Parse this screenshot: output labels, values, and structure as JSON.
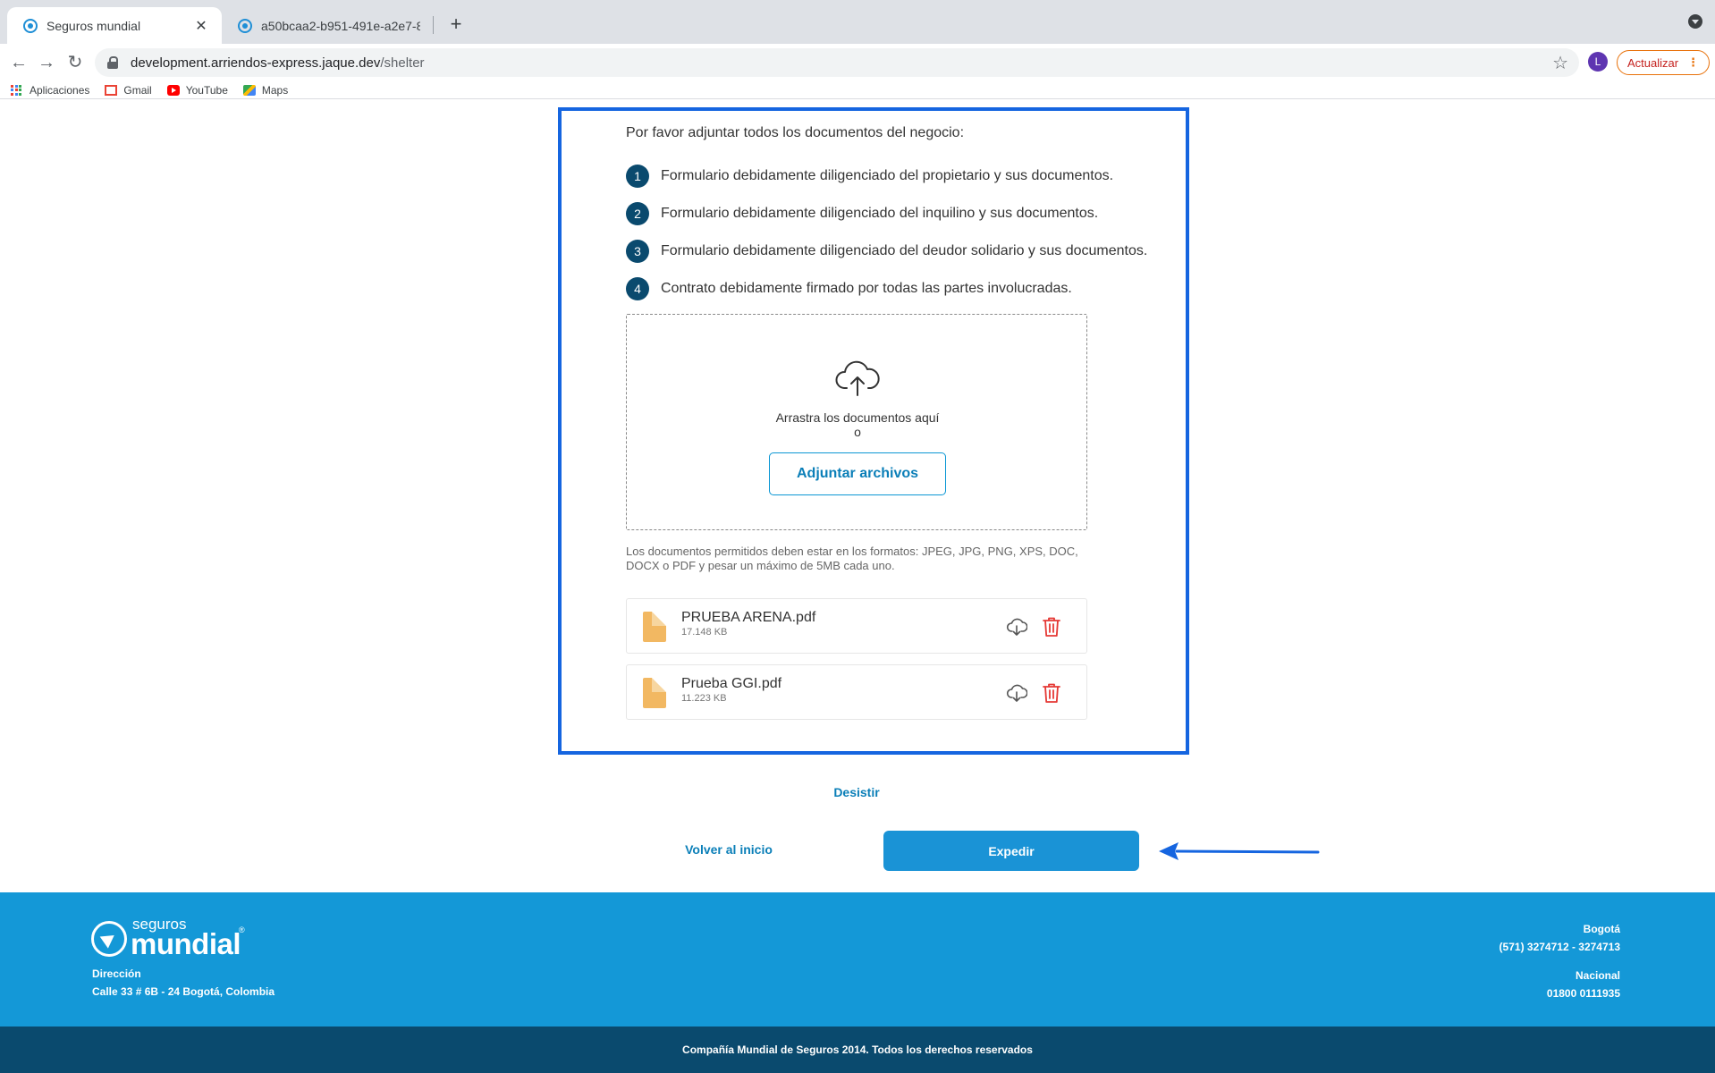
{
  "browser": {
    "tabs": [
      {
        "title": "Seguros mundial",
        "close": "✕"
      },
      {
        "title": "a50bcaa2-b951-491e-a2e7-8(",
        "close": ""
      }
    ],
    "new_tab": "+",
    "nav": {
      "back": "←",
      "forward": "→",
      "reload": "↻"
    },
    "url_host": "development.arriendos-express.jaque.dev",
    "url_path": "/shelter",
    "bookmark_star": "☆",
    "profile_initial": "L",
    "update_label": "Actualizar",
    "update_menu": "⋮",
    "bookmarks": [
      "Aplicaciones",
      "Gmail",
      "YouTube",
      "Maps"
    ]
  },
  "form": {
    "intro": "Por favor adjuntar todos los documentos del negocio:",
    "steps": [
      {
        "num": "1",
        "text": "Formulario debidamente diligenciado del propietario y sus documentos."
      },
      {
        "num": "2",
        "text": "Formulario debidamente diligenciado del inquilino y sus documentos."
      },
      {
        "num": "3",
        "text": "Formulario debidamente diligenciado del deudor solidario y sus documentos."
      },
      {
        "num": "4",
        "text": "Contrato debidamente firmado por todas las partes involucradas."
      }
    ],
    "dropzone": {
      "drag_text": "Arrastra los documentos aquí",
      "or_text": "o",
      "attach_label": "Adjuntar archivos"
    },
    "formats_note": "Los documentos permitidos deben estar en los formatos: JPEG, JPG, PNG, XPS, DOC, DOCX o PDF y pesar un máximo de 5MB cada uno.",
    "files": [
      {
        "name": "PRUEBA ARENA.pdf",
        "size": "17.148 KB"
      },
      {
        "name": "Prueba GGI.pdf",
        "size": "11.223 KB"
      }
    ],
    "desistir_label": "Desistir",
    "volver_label": "Volver al inicio",
    "expedir_label": "Expedir"
  },
  "footer": {
    "logo_small": "seguros",
    "logo_big": "mundial",
    "logo_reg": "®",
    "address_label": "Dirección",
    "address_value": "Calle 33 # 6B - 24 Bogotá, Colombia",
    "city_label": "Bogotá",
    "city_phone": "(571) 3274712 - 3274713",
    "national_label": "Nacional",
    "national_phone": "01800 0111935",
    "copyright": "Compañía Mundial de Seguros 2014. Todos los derechos reservados"
  },
  "colors": {
    "primary": "#1a93d6",
    "link": "#0b7fb8",
    "step_badge": "#0a4a6e",
    "highlight_border": "#1565e0",
    "delete_icon": "#e53935",
    "file_icon": "#f2b862",
    "footer_main": "#1498d7",
    "footer_bottom": "#0a4a6e"
  },
  "icons": {
    "upload": "cloud-upload-icon",
    "download": "cloud-download-icon",
    "delete": "trash-icon",
    "file": "file-icon",
    "annotation": "arrow-left-icon"
  }
}
